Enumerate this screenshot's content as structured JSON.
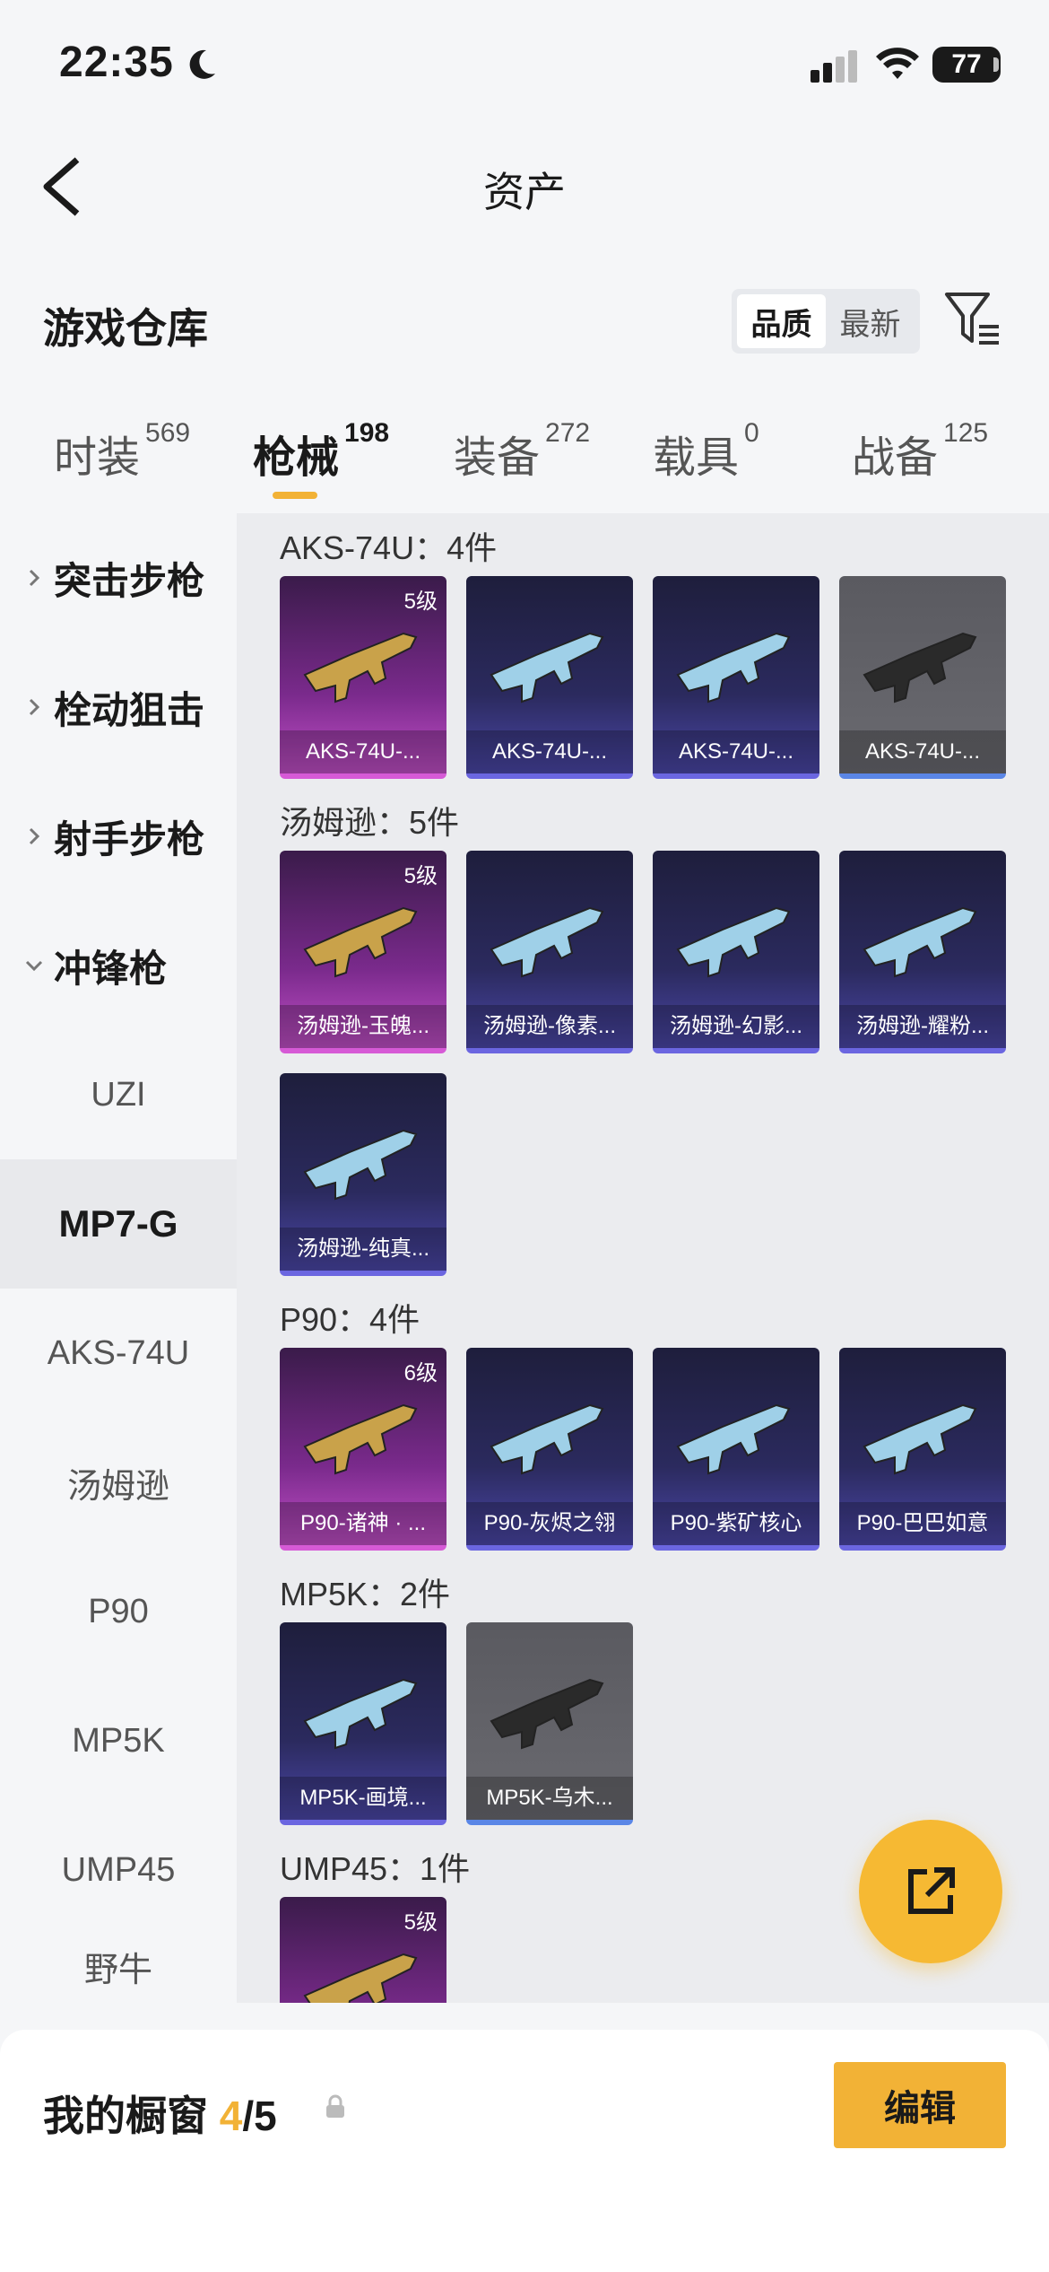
{
  "status_bar": {
    "time": "22:35",
    "battery": "77"
  },
  "header": {
    "title": "资产"
  },
  "section": {
    "title": "游戏仓库",
    "sort_options": [
      "品质",
      "最新"
    ]
  },
  "tabs": [
    {
      "label": "时装",
      "count": "569"
    },
    {
      "label": "枪械",
      "count": "198"
    },
    {
      "label": "装备",
      "count": "272"
    },
    {
      "label": "载具",
      "count": "0"
    },
    {
      "label": "战备",
      "count": "125"
    }
  ],
  "sidebar": {
    "categories": [
      "突击步枪",
      "栓动狙击",
      "射手步枪",
      "冲锋枪"
    ],
    "subitems": [
      "UZI",
      "MP7-G",
      "AKS-74U",
      "汤姆逊",
      "P90",
      "MP5K",
      "UMP45",
      "野牛"
    ]
  },
  "groups": [
    {
      "title": "AKS-74U：4件",
      "items": [
        {
          "label": "AKS-74U-...",
          "level": "5级",
          "tier": "pink"
        },
        {
          "label": "AKS-74U-...",
          "level": "",
          "tier": "blue"
        },
        {
          "label": "AKS-74U-...",
          "level": "",
          "tier": "blue"
        },
        {
          "label": "AKS-74U-...",
          "level": "",
          "tier": "gray"
        }
      ]
    },
    {
      "title": "汤姆逊：5件",
      "items": [
        {
          "label": "汤姆逊-玉魄...",
          "level": "5级",
          "tier": "pink"
        },
        {
          "label": "汤姆逊-像素...",
          "level": "",
          "tier": "blue"
        },
        {
          "label": "汤姆逊-幻影...",
          "level": "",
          "tier": "blue"
        },
        {
          "label": "汤姆逊-耀粉...",
          "level": "",
          "tier": "blue"
        },
        {
          "label": "汤姆逊-纯真...",
          "level": "",
          "tier": "blue"
        }
      ]
    },
    {
      "title": "P90：4件",
      "items": [
        {
          "label": "P90-诸神 · ...",
          "level": "6级",
          "tier": "pink"
        },
        {
          "label": "P90-灰烬之翎",
          "level": "",
          "tier": "blue"
        },
        {
          "label": "P90-紫矿核心",
          "level": "",
          "tier": "blue"
        },
        {
          "label": "P90-巴巴如意",
          "level": "",
          "tier": "blue"
        }
      ]
    },
    {
      "title": "MP5K：2件",
      "items": [
        {
          "label": "MP5K-画境...",
          "level": "",
          "tier": "blue"
        },
        {
          "label": "MP5K-乌木...",
          "level": "",
          "tier": "gray"
        }
      ]
    },
    {
      "title": "UMP45：1件",
      "items": [
        {
          "label": "",
          "level": "5级",
          "tier": "pink"
        }
      ]
    }
  ],
  "bottom": {
    "label": "我的橱窗",
    "current": "4",
    "total": "/5",
    "edit_label": "编辑"
  }
}
